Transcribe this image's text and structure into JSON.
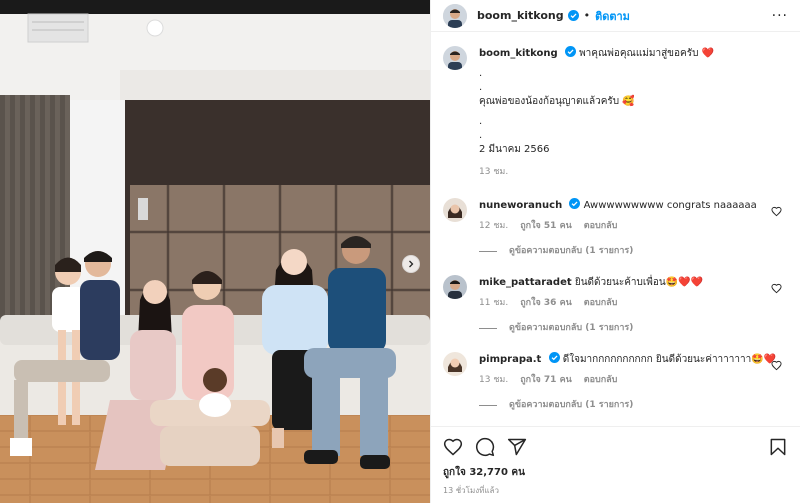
{
  "post": {
    "username": "boom_kitkong",
    "follow_label": "ติดตาม",
    "dot": "•",
    "more_label": "···"
  },
  "caption": {
    "username": "boom_kitkong",
    "text_line1": "พาคุณพ่อคุณแม่มาสู่ขอครับ ❤️",
    "dot_line1": ".",
    "dot_line2": ".",
    "text_line2": "คุณพ่อของน้องก้อนุญาตแล้วครับ 🥰",
    "dot_line3": ".",
    "dot_line4": ".",
    "date": "2 มีนาคม 2566",
    "time": "13 ชม."
  },
  "comments": [
    {
      "username": "nuneworanuch",
      "text": "Awwwwwwwww congrats naaaaaa",
      "time": "12 ชม.",
      "likes": "ถูกใจ 51 คน",
      "reply_label": "ตอบกลับ",
      "view_replies": "ดูข้อความตอบกลับ (1 รายการ)"
    },
    {
      "username": "mike_pattaradet",
      "text": "ยินดีด้วยนะค้าบเพื่อน🤩❤️❤️",
      "time": "11 ชม.",
      "likes": "ถูกใจ 36 คน",
      "reply_label": "ตอบกลับ",
      "view_replies": "ดูข้อความตอบกลับ (1 รายการ)"
    },
    {
      "username": "pimprapa.t",
      "text": "ดีใจมากกกกกกกกกก ยินดีด้วยนะค่าาาาาาา🤩❤️",
      "time": "13 ชม.",
      "likes": "ถูกใจ 71 คน",
      "reply_label": "ตอบกลับ",
      "view_replies": "ดูข้อความตอบกลับ (1 รายการ)"
    }
  ],
  "footer": {
    "likes": "ถูกใจ 32,770 คน",
    "ago": "13 ชั่วโมงที่แล้ว"
  },
  "icons": {
    "verified": "verified-badge-icon",
    "heart": "heart-icon",
    "comment": "comment-icon",
    "share": "share-icon",
    "save": "bookmark-icon",
    "next": "chevron-right-icon"
  },
  "colors": {
    "verified": "#0095f6",
    "follow": "#0095f6",
    "meta": "#8e8e8e"
  }
}
